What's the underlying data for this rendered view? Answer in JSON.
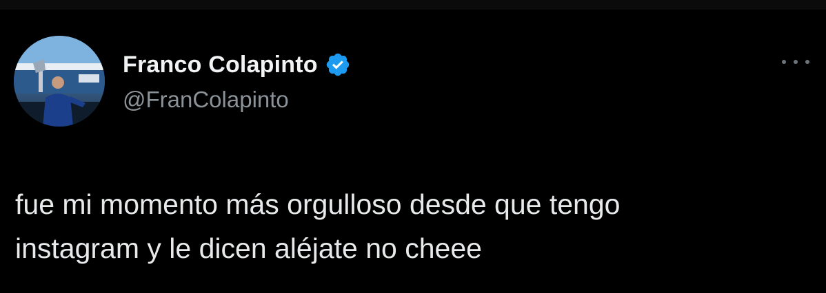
{
  "author": {
    "display_name": "Franco Colapinto",
    "handle": "@FranColapinto",
    "verified": true,
    "avatar_icon": "avatar-photo"
  },
  "tweet": {
    "text_lines": [
      "fue mi momento más orgulloso desde que tengo",
      "instagram y le dicen aléjate no cheee"
    ]
  },
  "colors": {
    "background": "#000000",
    "primary_text": "#e7e9ea",
    "secondary_text": "#8b9298",
    "verified_blue": "#1d9bf0"
  }
}
